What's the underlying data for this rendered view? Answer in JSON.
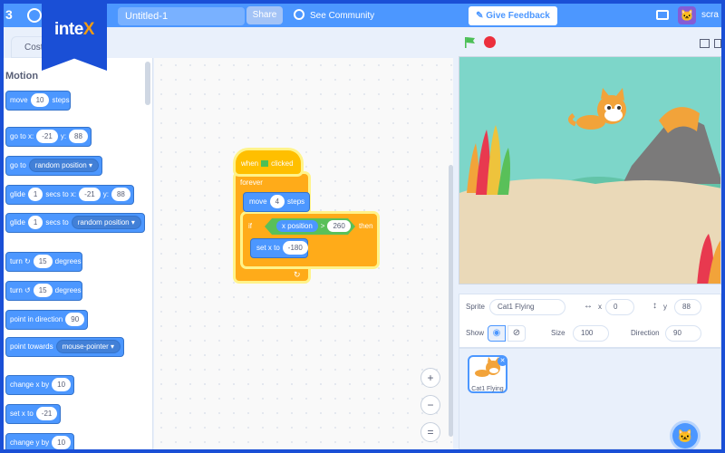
{
  "menubar": {
    "project_title": "Untitled-1",
    "share_label": "Share",
    "see_community_label": "See Community",
    "feedback_label": "Give Feedback",
    "user_name": "scra"
  },
  "branding": {
    "logo_main": "inte",
    "logo_x": "X"
  },
  "tabs": {
    "costumes": "Costu"
  },
  "palette": {
    "category": "Motion",
    "blocks": [
      {
        "pre": "move",
        "v1": "10",
        "post": "steps"
      },
      {
        "pre": "go to x:",
        "v1": "-21",
        "mid": "y:",
        "v2": "88"
      },
      {
        "pre": "go to",
        "dd": "random position"
      },
      {
        "pre": "glide",
        "v1": "1",
        "mid": "secs to x:",
        "v2": "-21",
        "mid2": "y:",
        "v3": "88"
      },
      {
        "pre": "glide",
        "v1": "1",
        "mid": "secs to",
        "dd": "random position"
      },
      {
        "pre": "turn",
        "v1": "15",
        "post": "degrees"
      },
      {
        "pre": "turn",
        "v1": "15",
        "post": "degrees"
      },
      {
        "pre": "point in direction",
        "v1": "90"
      },
      {
        "pre": "point towards",
        "dd": "mouse-pointer"
      },
      {
        "pre": "change x by",
        "v1": "10"
      },
      {
        "pre": "set x to",
        "v1": "-21"
      },
      {
        "pre": "change y by",
        "v1": "10"
      }
    ]
  },
  "script": {
    "hat_pre": "when",
    "hat_post": "clicked",
    "forever_label": "forever",
    "move_pre": "move",
    "move_val": "4",
    "move_post": "steps",
    "if_label": "if",
    "xpos_label": "x position",
    "gt": ">",
    "cmp_val": "260",
    "then_label": "then",
    "setx_label": "set x to",
    "setx_val": "-180"
  },
  "zoom": {
    "in": "+",
    "out": "−",
    "reset": "="
  },
  "sprite_info": {
    "sprite_label": "Sprite",
    "sprite_name": "Cat1 Flying",
    "x_label": "x",
    "x_value": "0",
    "y_label": "y",
    "y_value": "88",
    "show_label": "Show",
    "size_label": "Size",
    "size_value": "100",
    "direction_label": "Direction",
    "direction_value": "90"
  },
  "sprites": [
    {
      "name": "Cat1 Flying"
    }
  ],
  "colors": {
    "motion": "#4c97ff",
    "events": "#ffbf00",
    "control": "#ffab19",
    "operators": "#59c059",
    "menubar": "#4c97ff",
    "frame": "#1a4fd6"
  }
}
